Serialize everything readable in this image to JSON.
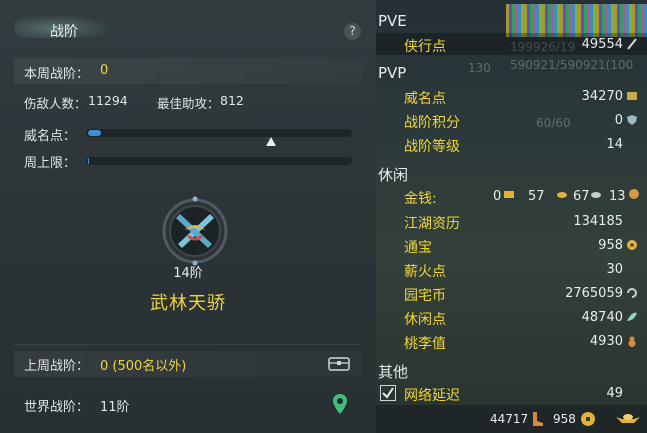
{
  "left": {
    "title": "战阶",
    "help": "?",
    "week_rank_label": "本周战阶：",
    "week_rank_value": "0",
    "kills_label": "伤敌人数：",
    "kills_value": "11294",
    "assist_label": "最佳助攻：",
    "assist_value": "812",
    "prestige_label": "威名点：",
    "prestige_progress": 0.05,
    "week_cap_label": "周上限：",
    "week_cap_progress": 0.0,
    "rank_level": "14阶",
    "rank_title": "武林天骄",
    "last_week_label": "上周战阶：",
    "last_week_value": "0 (500名以外)",
    "world_rank_label": "世界战阶：",
    "world_rank_value": "11阶"
  },
  "right": {
    "pve_header": "PVE",
    "pve_items": [
      {
        "label": "侠行点",
        "value": "49554"
      }
    ],
    "pvp_header": "PVP",
    "pvp_items": [
      {
        "label": "威名点",
        "value": "34270"
      },
      {
        "label": "战阶积分",
        "value": "0"
      },
      {
        "label": "战阶等级",
        "value": "14"
      }
    ],
    "leisure_header": "休闲",
    "money": {
      "label": "金钱:",
      "v1": "0",
      "v2": "57",
      "v3": "67",
      "v4": "13"
    },
    "leisure_items": [
      {
        "label": "江湖资历",
        "value": "134185"
      },
      {
        "label": "通宝",
        "value": "958"
      },
      {
        "label": "薪火点",
        "value": "30"
      },
      {
        "label": "园宅币",
        "value": "2765059"
      },
      {
        "label": "休闲点",
        "value": "48740"
      },
      {
        "label": "桃李值",
        "value": "4930"
      }
    ],
    "other_header": "其他",
    "latency_label": "网络延迟",
    "latency_value": "49",
    "ghost_1": "199926/19",
    "ghost_2": "130",
    "ghost_3": "590921/590921(100",
    "ghost_4": "60/60"
  },
  "bottom": {
    "v1": "44717",
    "v2": "958"
  },
  "colors": {
    "accent_yellow": "#f2d53c",
    "bar_blue": "#3b8fd6"
  }
}
